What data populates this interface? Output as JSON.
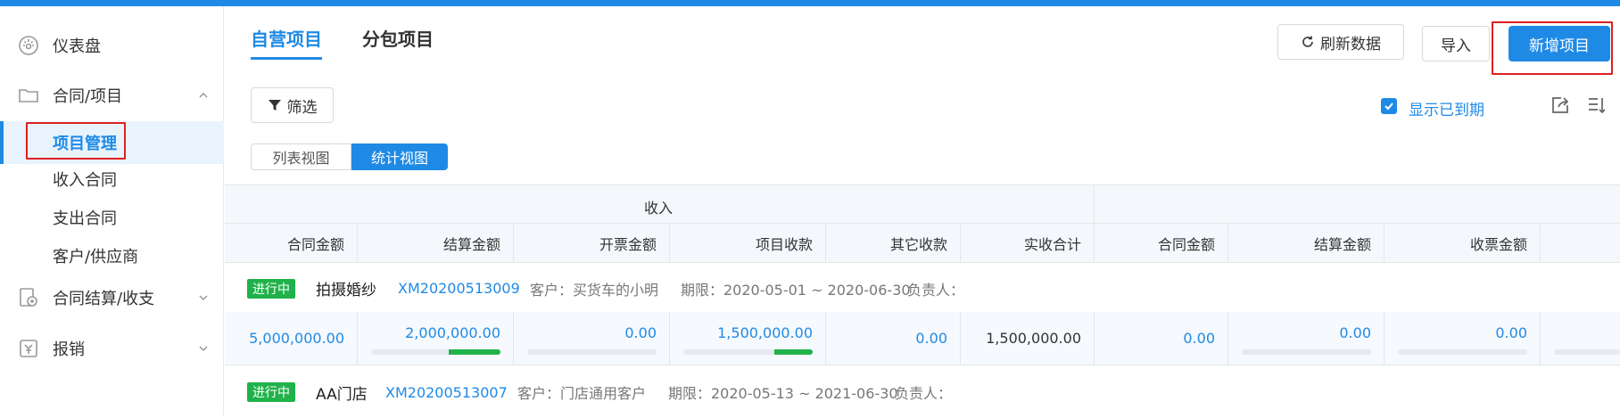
{
  "sidebar": {
    "items": [
      {
        "label": "仪表盘",
        "icon": "dashboard-icon"
      },
      {
        "label": "合同/项目",
        "icon": "folder-icon"
      },
      {
        "label": "合同结算/收支",
        "icon": "settlement-icon"
      },
      {
        "label": "报销",
        "icon": "reimburse-icon"
      }
    ],
    "sub_items": [
      {
        "label": "项目管理",
        "active": true
      },
      {
        "label": "收入合同"
      },
      {
        "label": "支出合同"
      },
      {
        "label": "客户/供应商"
      }
    ]
  },
  "header": {
    "tabs": [
      {
        "label": "自营项目",
        "active": true
      },
      {
        "label": "分包项目"
      }
    ],
    "refresh_label": "刷新数据",
    "import_label": "导入",
    "new_label": "新增项目"
  },
  "toolbar": {
    "filter_label": "筛选",
    "show_expired_label": "显示已到期",
    "show_expired_checked": true,
    "views": [
      {
        "label": "列表视图"
      },
      {
        "label": "统计视图",
        "active": true
      }
    ]
  },
  "table": {
    "group_income": "收入",
    "columns": [
      "合同金额",
      "结算金额",
      "开票金额",
      "项目收款",
      "其它收款",
      "实收合计",
      "合同金额",
      "结算金额",
      "收票金额"
    ],
    "projects": [
      {
        "status": "进行中",
        "name": "拍摄婚纱",
        "code": "XM20200513009",
        "customer": "客户：买货车的小明",
        "period": "期限：2020-05-01 ~ 2020-06-30",
        "owner": "负责人：",
        "values": [
          "5,000,000.00",
          "2,000,000.00",
          "0.00",
          "1,500,000.00",
          "0.00",
          "1,500,000.00",
          "0.00",
          "0.00",
          "0.00"
        ],
        "progress": [
          null,
          0.4,
          0,
          0.3,
          null,
          null,
          null,
          0,
          0
        ]
      },
      {
        "status": "进行中",
        "name": "AA门店",
        "code": "XM20200513007",
        "customer": "客户：门店通用客户",
        "period": "期限：2020-05-13 ~ 2021-06-30",
        "owner": "负责人："
      }
    ]
  },
  "colors": {
    "accent": "#1f8ae6",
    "success": "#20b24a",
    "highlight": "#e02020"
  }
}
